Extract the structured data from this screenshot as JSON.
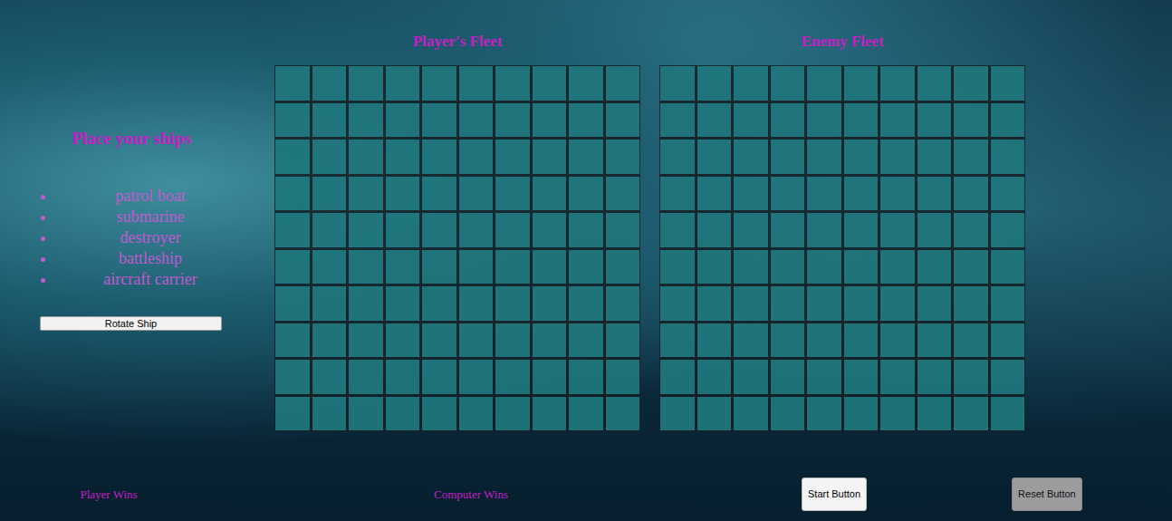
{
  "sidebar": {
    "title": "Place your ships",
    "ships": [
      "patrol boat",
      "submarine",
      "destroyer",
      "battleship",
      "aircraft carrier"
    ],
    "rotate_button": "Rotate Ship"
  },
  "boards": [
    {
      "title": "Player's Fleet",
      "cells": [
        [
          false,
          false,
          false,
          false,
          false,
          false,
          false,
          false,
          false,
          false
        ],
        [
          false,
          false,
          false,
          false,
          false,
          false,
          false,
          false,
          false,
          false
        ],
        [
          false,
          false,
          false,
          false,
          false,
          false,
          false,
          false,
          false,
          false
        ],
        [
          false,
          false,
          false,
          false,
          false,
          false,
          false,
          false,
          false,
          false
        ],
        [
          false,
          false,
          false,
          false,
          false,
          false,
          false,
          false,
          false,
          false
        ],
        [
          false,
          false,
          false,
          false,
          false,
          false,
          false,
          false,
          false,
          false
        ],
        [
          false,
          false,
          false,
          false,
          false,
          false,
          false,
          false,
          false,
          false
        ],
        [
          false,
          false,
          false,
          false,
          false,
          false,
          false,
          false,
          false,
          false
        ],
        [
          false,
          false,
          false,
          false,
          false,
          false,
          false,
          false,
          false,
          false
        ],
        [
          false,
          false,
          false,
          false,
          false,
          false,
          false,
          false,
          false,
          false
        ]
      ]
    },
    {
      "title": "Enemy Fleet",
      "cells": [
        [
          false,
          false,
          false,
          false,
          false,
          false,
          false,
          false,
          false,
          false
        ],
        [
          false,
          false,
          false,
          false,
          false,
          false,
          false,
          false,
          false,
          false
        ],
        [
          false,
          false,
          false,
          false,
          false,
          false,
          false,
          false,
          false,
          false
        ],
        [
          false,
          false,
          false,
          false,
          false,
          false,
          false,
          false,
          false,
          false
        ],
        [
          false,
          false,
          false,
          false,
          false,
          false,
          false,
          false,
          false,
          false
        ],
        [
          false,
          false,
          false,
          false,
          false,
          false,
          false,
          false,
          false,
          false
        ],
        [
          false,
          false,
          false,
          false,
          false,
          false,
          false,
          false,
          false,
          false
        ],
        [
          false,
          false,
          false,
          false,
          false,
          false,
          false,
          false,
          false,
          false
        ],
        [
          false,
          false,
          false,
          false,
          false,
          false,
          false,
          false,
          false,
          false
        ],
        [
          false,
          false,
          false,
          false,
          false,
          false,
          false,
          false,
          false,
          false
        ]
      ]
    }
  ],
  "scores": [
    "Player Wins",
    "Computer Wins"
  ],
  "buttons": [
    {
      "label": "Start Button",
      "disabled": false
    },
    {
      "label": "Reset Button",
      "disabled": true
    }
  ]
}
